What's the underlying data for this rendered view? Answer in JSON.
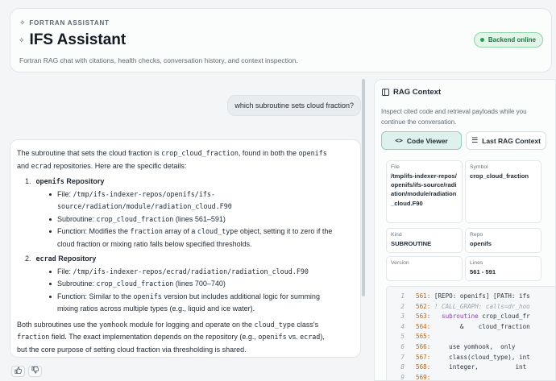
{
  "header": {
    "eyebrow": "FORTRAN ASSISTANT",
    "title": "IFS Assistant",
    "subtitle": "Fortran RAG chat with citations, health checks, conversation history, and context inspection.",
    "status_badge": "Backend online"
  },
  "chat": {
    "user_message": "which subroutine sets cloud fraction?",
    "assistant": {
      "intro_1": "The subroutine that sets the cloud fraction is ",
      "intro_code": "crop_cloud_fraction",
      "intro_2": ", found in both the ",
      "intro_code2": "openifs",
      "intro_3": "and ",
      "intro_code3": "ecrad",
      "intro_4": " repositories. Here are the specific details:",
      "repos": [
        {
          "num": "1.",
          "name": "openifs",
          "suffix": " Repository",
          "file_label": "File: ",
          "file_path_1": "/tmp/ifs-indexer-repos/openifs/ifs-",
          "file_path_2": "source/radiation/module/radiation_cloud.F90",
          "sub_label": "Subroutine: ",
          "sub_code": "crop_cloud_fraction",
          "sub_lines": " (lines 561–591)",
          "fn_1": "Function: Modifies the ",
          "fn_code1": "fraction",
          "fn_2": " array of a ",
          "fn_code2": "cloud_type",
          "fn_3": " object, setting it to zero if the",
          "fn_4": "cloud fraction or mixing ratio falls below specified thresholds."
        },
        {
          "num": "2.",
          "name": "ecrad",
          "suffix": " Repository",
          "file_label": "File: ",
          "file_path_1": "/tmp/ifs-indexer-repos/ecrad/radiation/radiation_cloud.F90",
          "sub_label": "Subroutine: ",
          "sub_code": "crop_cloud_fraction",
          "sub_lines": " (lines 700–740)",
          "fn_1": "Function: Similar to the ",
          "fn_code1": "openifs",
          "fn_2": " version but includes additional logic for summing",
          "fn_4": "mixing ratios across multiple types (e.g., liquid and ice water)."
        }
      ],
      "outro_1": "Both subroutines use the ",
      "outro_code1": "yomhook",
      "outro_2": " module for logging and operate on the ",
      "outro_code2": "cloud_type",
      "outro_3": " class's",
      "outro_code3": "fraction",
      "outro_4": " field. The exact implementation depends on the repository (e.g., ",
      "outro_code4": "openifs",
      "outro_5": " vs. ",
      "outro_code5": "ecrad",
      "outro_6": "),",
      "outro_7": "but the core purpose of setting cloud fraction via thresholding is shared."
    },
    "feedback": {
      "up": "👍",
      "down": "👎"
    }
  },
  "rag": {
    "title": "RAG Context",
    "description": "Inspect cited code and retrieval payloads while you continue the conversation.",
    "tabs": {
      "code_viewer": "Code Viewer",
      "last_rag": "Last RAG Context"
    },
    "meta": {
      "file_label": "File",
      "file_value": "/tmp/ifs-indexer-repos/openifs/ifs-source/radiation/module/radiation_cloud.F90",
      "symbol_label": "Symbol",
      "symbol_value": "crop_cloud_fraction",
      "kind_label": "Kind",
      "kind_value": "SUBROUTINE",
      "repo_label": "Repo",
      "repo_value": "openifs",
      "version_label": "Version",
      "version_value": "",
      "lines_label": "Lines",
      "lines_value": "561 - 591"
    },
    "code_lines": [
      {
        "n": "1",
        "num": "561:",
        "text": " [REPO: openifs] [PATH: ifs"
      },
      {
        "n": "2",
        "num": "562:",
        "cm": " ! CALL_GRAPH: calls=dr_hoo"
      },
      {
        "n": "3",
        "num": "563:",
        "kw": "   subroutine",
        "text": " crop_cloud_fr"
      },
      {
        "n": "4",
        "num": "564:",
        "text": "        &    cloud_fraction"
      },
      {
        "n": "5",
        "num": "565:",
        "text": ""
      },
      {
        "n": "6",
        "num": "566:",
        "text": "     use yomhook,  only"
      },
      {
        "n": "7",
        "num": "567:",
        "text": "     class(cloud_type), int"
      },
      {
        "n": "8",
        "num": "568:",
        "text": "     integer,          int"
      },
      {
        "n": "9",
        "num": "569:",
        "text": ""
      }
    ]
  }
}
